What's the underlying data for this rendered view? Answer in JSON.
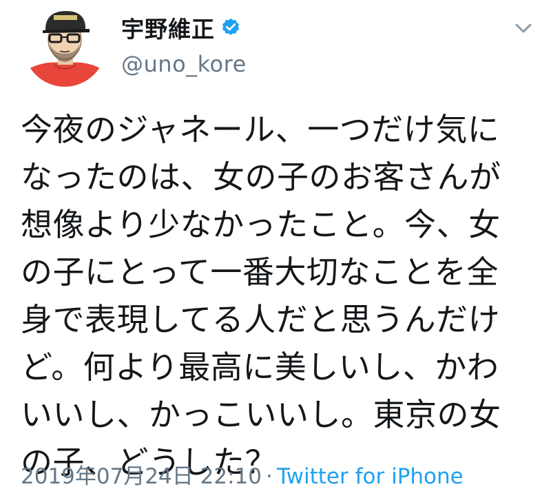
{
  "tweet": {
    "display_name": "宇野維正",
    "handle": "@uno_kore",
    "verified_icon": "verified-badge-icon",
    "body_lines": [
      "今夜のジャネール、一つだけ気に",
      "なったのは、女の子のお客さんが",
      "想像より少なかったこと。今、女",
      "の子にとって一番大切なことを全",
      "身で表現してる人だと思うんだけ",
      "ど。何より最高に美しいし、かわ",
      "いいし、かっこいいし。東京の女",
      "の子、どうした？"
    ],
    "timestamp": "2019年07月24日 22:10",
    "separator": "·",
    "source": "Twitter for iPhone"
  },
  "colors": {
    "text": "#14171a",
    "secondary": "#657786",
    "link": "#1da1f2",
    "verified": "#1da1f2",
    "avatar_shirt": "#e8463a"
  }
}
